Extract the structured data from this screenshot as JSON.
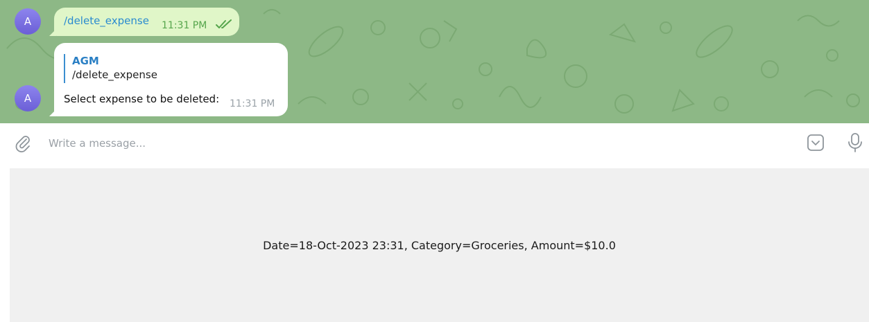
{
  "messages": [
    {
      "avatar_letter": "A",
      "text": "/delete_expense",
      "time": "11:31 PM",
      "status_icon": "double-check-icon"
    },
    {
      "avatar_letter": "A",
      "reply_to": {
        "sender": "AGM",
        "text": "/delete_expense"
      },
      "text": "Select expense to be deleted:",
      "time": "11:31 PM"
    }
  ],
  "composer": {
    "placeholder": "Write a message...",
    "attach_icon": "paperclip-icon",
    "emoji_icon": "sticker-icon",
    "mic_icon": "microphone-icon"
  },
  "keyboard": {
    "buttons": [
      "Date=18-Oct-2023 23:31,  Category=Groceries,  Amount=$10.0"
    ]
  },
  "colors": {
    "chat_background": "#8db886",
    "outgoing_bubble": "#e0f6c8",
    "incoming_bubble": "#ffffff",
    "avatar": "#7b70e0",
    "link_blue": "#2a8bd0",
    "keyboard_bg": "#f0f0f0"
  }
}
